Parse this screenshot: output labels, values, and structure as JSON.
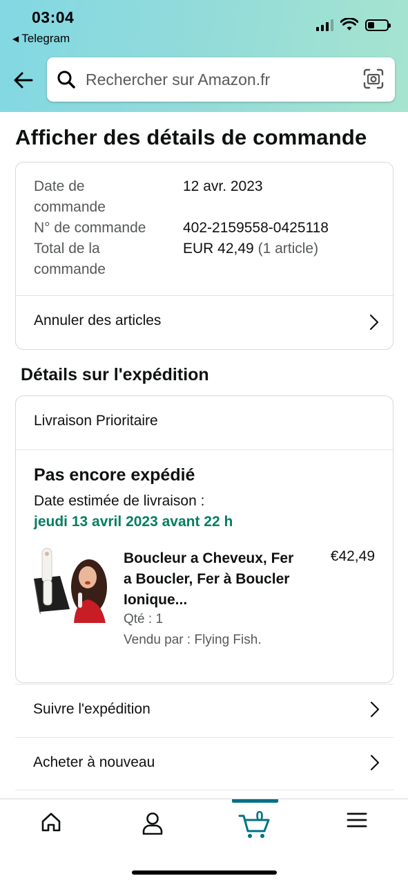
{
  "status_bar": {
    "time": "03:04",
    "back_app": "Telegram"
  },
  "search": {
    "placeholder": "Rechercher sur Amazon.fr"
  },
  "page": {
    "title": "Afficher des détails de commande"
  },
  "order_summary": {
    "date_label_1": "Date de",
    "date_label_2": "commande",
    "date_value": "12 avr. 2023",
    "number_label": "N° de commande",
    "number_value": "402-2159558-0425118",
    "total_label_1": "Total de la",
    "total_label_2": "commande",
    "total_value": "EUR 42,49",
    "total_items": "(1 article)",
    "cancel_label": "Annuler des articles"
  },
  "shipping": {
    "section_title": "Détails sur l'expédition",
    "method": "Livraison Prioritaire",
    "status": "Pas encore expédié",
    "estimated_label": "Date estimée de livraison :",
    "estimated_date": "jeudi 13 avril 2023 avant 22 h",
    "product": {
      "title": "Boucleur a Cheveux, Fer a Boucler, Fer à Boucler Ionique...",
      "price": "€42,49",
      "quantity": "Qté : 1",
      "seller": "Vendu par : Flying Fish."
    }
  },
  "actions": {
    "track": "Suivre l'expédition",
    "buy_again": "Acheter à nouveau"
  },
  "bottom_nav": {
    "cart_count": "0"
  },
  "colors": {
    "accent_teal": "#007185",
    "delivery_green": "#067d62",
    "header_gradient_start": "#82d8e3",
    "header_gradient_end": "#a6e4cf"
  }
}
